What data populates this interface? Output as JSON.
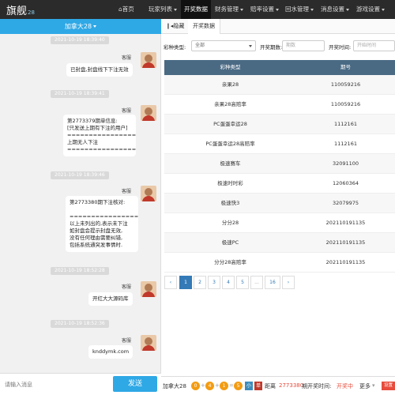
{
  "nav": {
    "logo": "旗舰",
    "logo_sub": "28",
    "items": [
      "首页",
      "玩家列表",
      "开奖数据",
      "财务管理",
      "赔率设置",
      "回水管理",
      "消息设置",
      "游戏设置"
    ]
  },
  "chat": {
    "room": "加拿大28",
    "messages": [
      {
        "time": "2021-10-19 18:39:40",
        "sender": "客服",
        "text": "已封盘,封盘线下下注无效"
      },
      {
        "time": "2021-10-19 18:39:41",
        "sender": "客服",
        "text": "第2773379期单信息:\n[只发送上期有下注的用户]\n================\n上期无人下注\n================"
      },
      {
        "time": "2021-10-19 18:39:46",
        "sender": "客服",
        "text": "第2773380期下注核对:\n\n================\n以上未列出的,表示未下注\n如封盘会提示封盘无效,\n没有任何理由需要纠错,\n包括系统通突发事情时."
      },
      {
        "time": "2021-10-19 18:52:28",
        "sender": "客服",
        "text": "开红大大源码库"
      },
      {
        "time": "2021-10-19 18:52:36",
        "sender": "客服",
        "text": "knddymk.com"
      }
    ],
    "input_placeholder": "请输入消息",
    "send_label": "发送"
  },
  "tabs": {
    "hide": "隐藏",
    "current": "开奖数据"
  },
  "filter": {
    "type_label": "彩种类型:",
    "type_value": "全部",
    "period_label": "开奖期数:",
    "period_placeholder": "期数",
    "time_label": "开奖时间:",
    "time_placeholder": "开始时间"
  },
  "table": {
    "headers": [
      "彩种类型",
      "期号"
    ],
    "rows": [
      [
        "亲果28",
        "110059216"
      ],
      [
        "亲果28高赔率",
        "110059216"
      ],
      [
        "PC蛋蛋幸运28",
        "1112161"
      ],
      [
        "PC蛋蛋幸运28高赔率",
        "1112161"
      ],
      [
        "极速赛车",
        "32091100"
      ],
      [
        "极速时时彩",
        "12060364"
      ],
      [
        "极速快3",
        "32079975"
      ],
      [
        "分分28",
        "202110191135"
      ],
      [
        "极速PC",
        "202110191135"
      ],
      [
        "分分28高赔率",
        "202110191135"
      ]
    ]
  },
  "pager": [
    "‹",
    "1",
    "2",
    "3",
    "4",
    "5",
    "...",
    "16",
    "›"
  ],
  "bottom": {
    "game": "加拿大28",
    "balls": [
      "0",
      "4",
      "1",
      "5"
    ],
    "tags": [
      "小",
      "单"
    ],
    "text1": "距离",
    "period": "2773380",
    "text2": "期开奖时间:",
    "status": "开奖中",
    "more": "更多",
    "settings": "设置"
  },
  "colors": {
    "accent": "#2fa8e6",
    "table_head": "#4a6a84",
    "ball": "#f39c12",
    "pager_active": "#337ab7"
  }
}
